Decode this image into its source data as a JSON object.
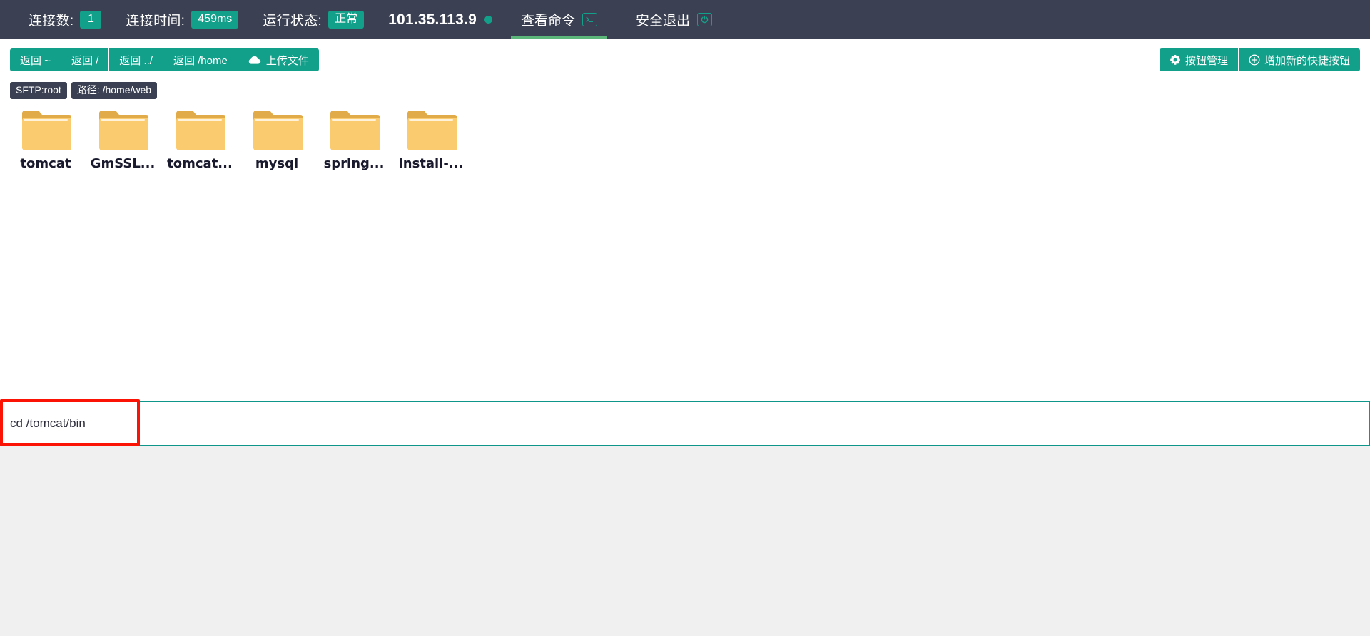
{
  "header": {
    "connections": {
      "label": "连接数:",
      "value": "1"
    },
    "conn_time": {
      "label": "连接时间:",
      "value": "459ms"
    },
    "run_status": {
      "label": "运行状态:",
      "value": "正常"
    },
    "ip": "101.35.113.9",
    "status_dot_color": "#12a08a",
    "tabs": [
      {
        "label": "查看命令",
        "icon": "terminal-icon",
        "active": true
      },
      {
        "label": "安全退出",
        "icon": "power-icon",
        "active": false
      }
    ],
    "bg_color": "#3b4152",
    "accent_color": "#12a08a",
    "active_underline_color": "#5cb87a"
  },
  "toolbar": {
    "left_buttons": [
      {
        "label": "返回 ~",
        "icon": ""
      },
      {
        "label": "返回 /",
        "icon": ""
      },
      {
        "label": "返回 ../",
        "icon": ""
      },
      {
        "label": "返回 /home",
        "icon": ""
      },
      {
        "label": "上传文件",
        "icon": "cloud-upload-icon"
      }
    ],
    "right_buttons": [
      {
        "label": "按钮管理",
        "icon": "gear-icon"
      },
      {
        "label": "增加新的快捷按钮",
        "icon": "plus-circle-icon"
      }
    ],
    "button_color": "#12a08a"
  },
  "path": {
    "protocol_chip": "SFTP:root",
    "path_label": "路径:",
    "path_value": "/home/web",
    "chip_bg": "#3b4152"
  },
  "files": [
    {
      "name": "tomcat",
      "type": "folder"
    },
    {
      "name": "GmSSL...",
      "type": "folder"
    },
    {
      "name": "tomcat...",
      "type": "folder"
    },
    {
      "name": "mysql",
      "type": "folder"
    },
    {
      "name": "spring...",
      "type": "folder"
    },
    {
      "name": "install-...",
      "type": "folder"
    }
  ],
  "folder_colors": {
    "body": "#fbcb6f",
    "tab": "#e2ab4a",
    "notch": "#ffffff"
  },
  "command": {
    "value": "cd /tomcat/bin",
    "placeholder": "",
    "border_color": "#0f968a",
    "highlight_color": "#fb1405"
  },
  "bottom": {
    "bg_color": "#f0f0f0"
  }
}
